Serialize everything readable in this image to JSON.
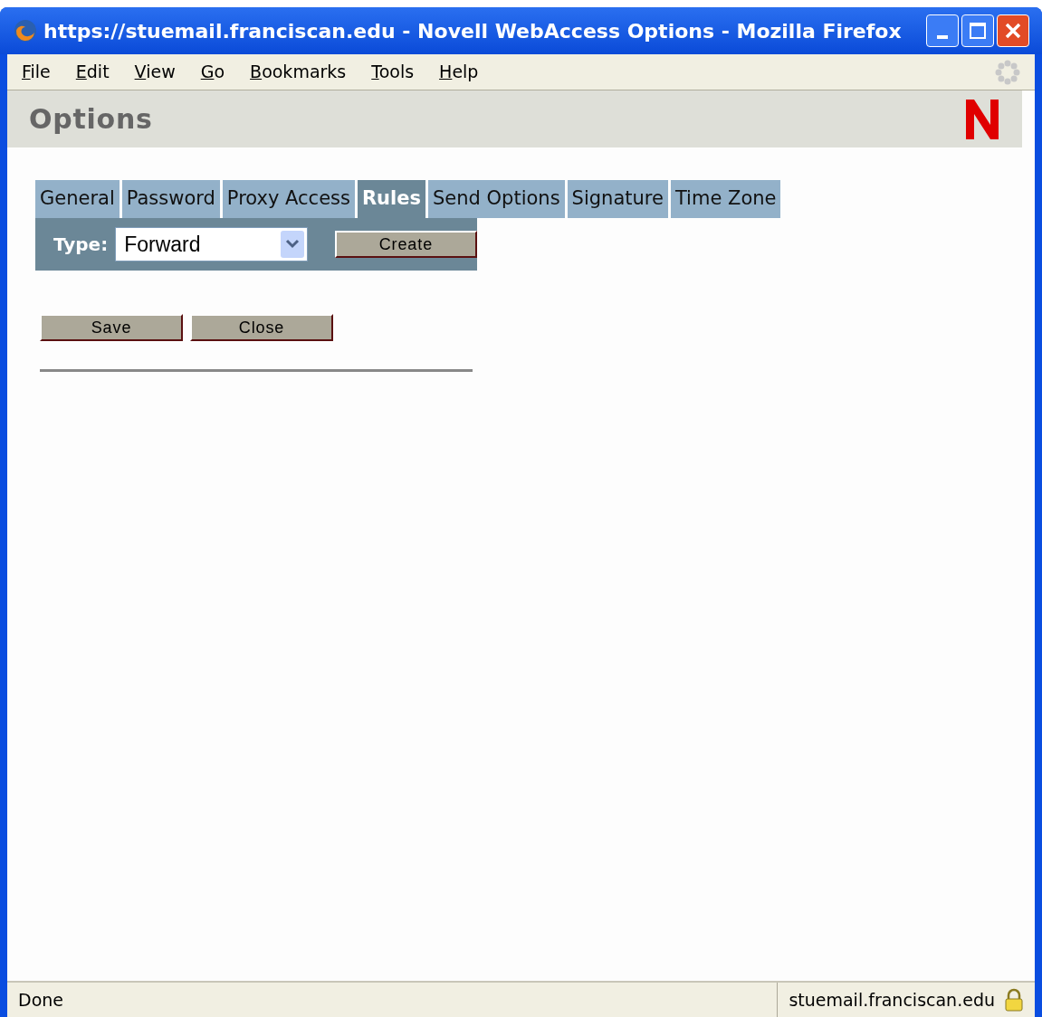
{
  "window": {
    "title": "https://stuemail.franciscan.edu - Novell WebAccess Options - Mozilla Firefox"
  },
  "menu": [
    "File",
    "Edit",
    "View",
    "Go",
    "Bookmarks",
    "Tools",
    "Help"
  ],
  "page": {
    "heading": "Options",
    "tabs": [
      {
        "label": "General",
        "selected": false
      },
      {
        "label": "Password",
        "selected": false
      },
      {
        "label": "Proxy Access",
        "selected": false
      },
      {
        "label": "Rules",
        "selected": true
      },
      {
        "label": "Send Options",
        "selected": false
      },
      {
        "label": "Signature",
        "selected": false
      },
      {
        "label": "Time Zone",
        "selected": false
      }
    ],
    "type_label": "Type:",
    "type_value": "Forward",
    "create_button": "Create",
    "buttons": [
      "Save",
      "Close"
    ]
  },
  "status_bar": {
    "status": "Done",
    "host": "stuemail.franciscan.edu"
  }
}
